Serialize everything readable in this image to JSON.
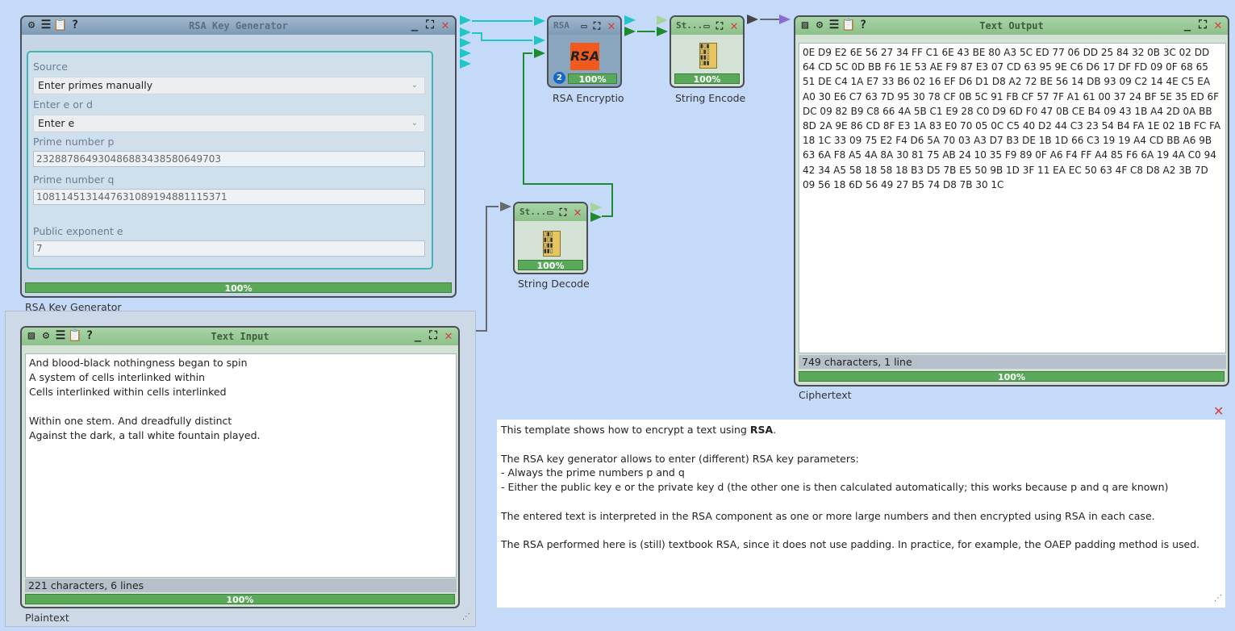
{
  "colors": {
    "background": "#c5daf8",
    "connector_teal": "#1fc6c6",
    "connector_green": "#1e8a2e",
    "connector_gray": "#666a70",
    "connector_purple": "#8a6bd0",
    "progress": "#5aa95a",
    "close_red": "#d64040"
  },
  "key_generator": {
    "title": "RSA Key Generator",
    "caption": "RSA Key Generator",
    "source_label": "Source",
    "source_value": "Enter primes manually",
    "e_or_d_label": "Enter e or d",
    "e_or_d_value": "Enter e",
    "p_label": "Prime number p",
    "p_value": "23288786493048688343858064970​3",
    "q_label": "Prime number q",
    "q_value": "108114513144763108919488111537​1",
    "e_label": "Public exponent e",
    "e_value": "7",
    "progress": "100%"
  },
  "rsa_encryption": {
    "title": "RSA",
    "logo_text": "RSA",
    "badge": "2",
    "progress": "100%",
    "caption": "RSA Encryptio"
  },
  "string_encode": {
    "title": "St...",
    "progress": "100%",
    "caption": "String Encode"
  },
  "string_decode": {
    "title": "St...",
    "progress": "100%",
    "caption": "String Decode"
  },
  "text_output": {
    "title": "Text Output",
    "caption": "Ciphertext",
    "content": "0E D9 E2 6E 56 27 34 FF C1 6E 43 BE 80 A3 5C ED 77 06 DD 25 84 32 0B 3C 02 DD 64 CD 5C 0D BB F6 1E 53 AE F9 87 E3 07 CD 63 95 9E C6 D6 17 DF FD 09 0F 68 65 51 DE C4 1A E7 33 B6 02 16 EF D6 D1 D8 A2 72 BE 56 14 DB 93 09 C2 14 4E C5 EA A0 30 E6 C7 63 7D 95 30 78 CF 0B 5C 91 FB CF 57 7F A1 61 00 37 24 BF 5E 35 ED 6F DC 09 82 B9 C8 66 4A 5B C1 E9 28 C0 D9 6D F0 47 0B CE B4 09 43 1B A4 2D 0A BB 8D 2A 9E 86 CD 8F E3 1A 83 E0 70 05 0C C5 40 D2 44 C3 23 54 B4 FA 1E 02 1B FC FA 18 1C 33 09 75 E2 F4 D6 5A 70 03 A3 D7 B3 DE 1B 1D 66 C3 19 19 A4 CD BB A6 9B 63 6A F8 A5 4A 8A 30 81 75 AB 24 10 35 F9 89 0F A6 F4 FF A4 85 F6 6A 19 4A C0 94 42 34 A5 58 18 58 18 B3 D5 7B E5 50 9B 1D 3F 11 EA EC 50 63 4F C8 D8 A2 3B 7D 09 56 18 6D 56 49 27 B5 74 D8 7B 30 1C",
    "status": "749 characters,  1 line",
    "progress": "100%"
  },
  "text_input": {
    "title": "Text Input",
    "caption": "Plaintext",
    "content": "And blood-black nothingness began to spin\nA system of cells interlinked within\nCells interlinked within cells interlinked\n\nWithin one stem. And dreadfully distinct\nAgainst the dark, a tall white fountain played.",
    "status": "221 characters,  6 lines",
    "progress": "100%"
  },
  "note": {
    "p1_prefix": "This template shows how to encrypt a text using ",
    "p1_bold": "RSA",
    "p1_suffix": ".",
    "p2": "The RSA key generator allows to enter (different) RSA key parameters:",
    "p2_b1": "- Always the prime numbers p and q",
    "p2_b2": "- Either the public key e or the private key d (the other one is then calculated automatically; this works because p and q are known)",
    "p3": "The entered text is interpreted in the RSA component as one or more large numbers and then encrypted using RSA in each case.",
    "p4": "The RSA performed here is (still) textbook RSA, since it does not use padding. In practice, for example, the OAEP padding method is used."
  },
  "icons": {
    "gear": "gear-icon",
    "menu": "menu-icon",
    "clipboard": "clipboard-icon",
    "help": "help-icon",
    "picture": "picture-icon",
    "minimize": "minimize-icon",
    "maximize": "maximize-icon",
    "close": "close-icon"
  }
}
